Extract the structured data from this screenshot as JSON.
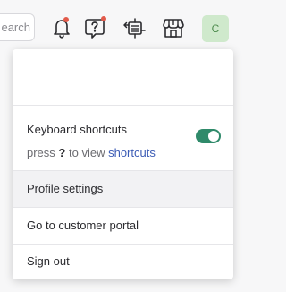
{
  "header": {
    "search": {
      "placeholder": "earch"
    },
    "icons": [
      "notification-bell-icon",
      "help-question-icon",
      "integrations-icon",
      "store-icon"
    ],
    "avatar_initial": "C"
  },
  "menu": {
    "keyboard_shortcuts": {
      "title": "Keyboard shortcuts",
      "hint_prefix": "press",
      "hint_key": "?",
      "hint_middle": "to view",
      "hint_link": "shortcuts",
      "enabled": true
    },
    "items": [
      {
        "label": "Profile settings"
      },
      {
        "label": "Go to customer portal"
      },
      {
        "label": "Sign out"
      }
    ]
  },
  "colors": {
    "toggle_on": "#2f8a6a",
    "badge_dot": "#e25a4a",
    "link": "#3b5bb5",
    "avatar_bg": "#cfe9cc"
  }
}
